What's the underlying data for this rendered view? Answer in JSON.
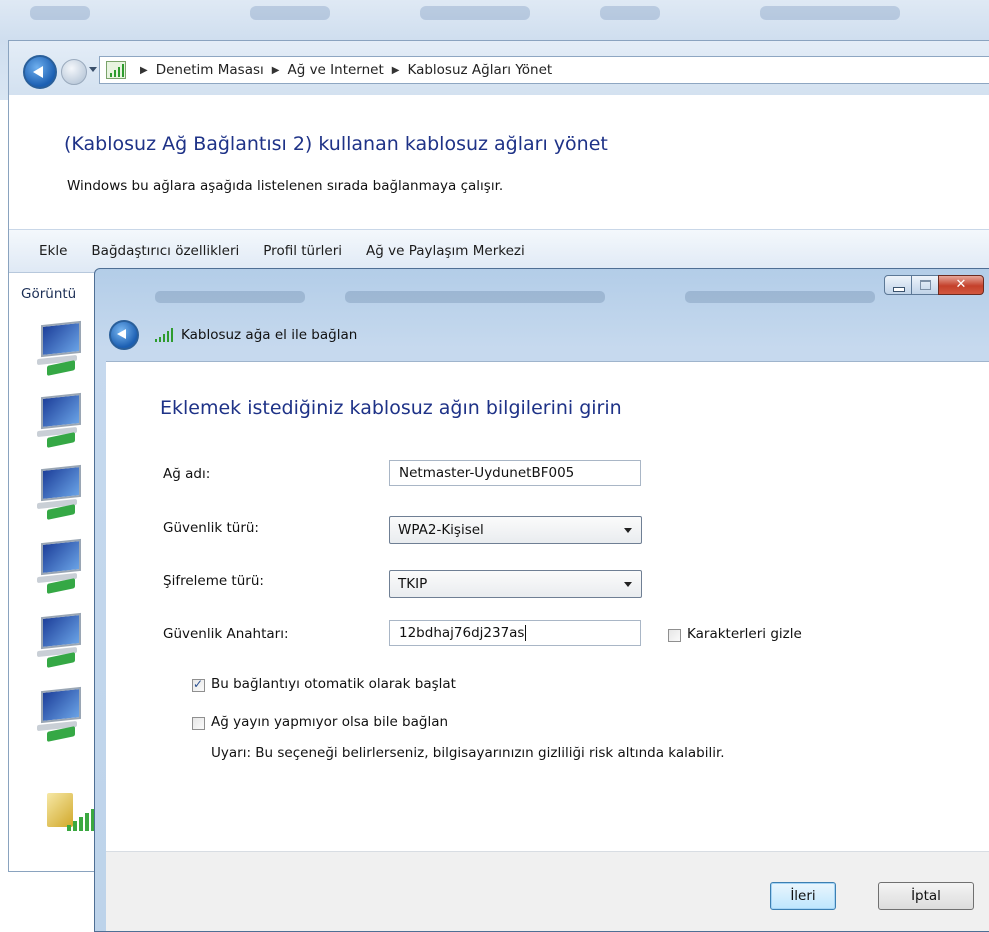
{
  "breadcrumb": {
    "items": [
      "Denetim Masası",
      "Ağ ve Internet",
      "Kablosuz Ağları Yönet"
    ]
  },
  "outer": {
    "title": "(Kablosuz Ağ Bağlantısı 2) kullanan kablosuz ağları yönet",
    "description": "Windows bu ağlara aşağıda listelenen sırada bağlanmaya çalışır.",
    "toolbar": [
      "Ekle",
      "Bağdaştırıcı özellikleri",
      "Profil türleri",
      "Ağ ve Paylaşım Merkezi"
    ],
    "view_label": "Görüntü"
  },
  "dialog": {
    "header_title": "Kablosuz ağa el ile bağlan",
    "title": "Eklemek istediğiniz kablosuz ağın bilgilerini girin",
    "fields": {
      "network_name_label": "Ağ adı:",
      "network_name_value": "Netmaster-UydunetBF005",
      "security_type_label": "Güvenlik türü:",
      "security_type_value": "WPA2-Kişisel",
      "encryption_type_label": "Şifreleme türü:",
      "encryption_type_value": "TKIP",
      "security_key_label": "Güvenlik Anahtarı:",
      "security_key_value": "12bdhaj76dj237as"
    },
    "hide_chars_label": "Karakterleri gizle",
    "hide_chars_checked": false,
    "auto_start_label": "Bu bağlantıyı otomatik olarak başlat",
    "auto_start_checked": true,
    "connect_hidden_label": "Ağ yayın yapmıyor olsa bile bağlan",
    "connect_hidden_checked": false,
    "warning": "Uyarı: Bu seçeneği belirlerseniz, bilgisayarınızın gizliliği risk altında kalabilir.",
    "next_label": "İleri",
    "cancel_label": "İptal"
  },
  "colors": {
    "title_blue": "#1e3287",
    "close_red": "#c4402b"
  }
}
